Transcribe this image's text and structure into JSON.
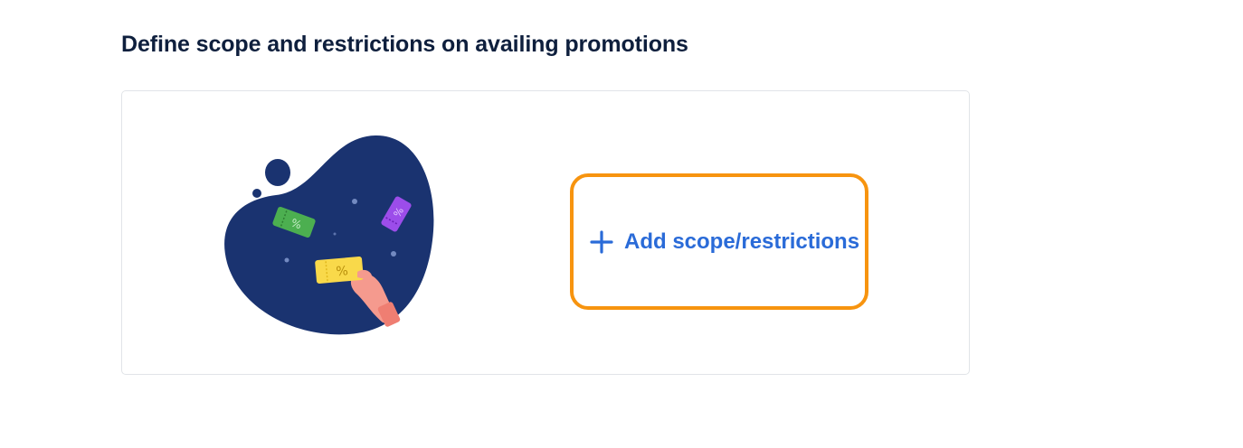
{
  "section": {
    "title": "Define scope and restrictions on availing promotions"
  },
  "card": {
    "illustration_icon": "coupon-tickets-hand-illustration",
    "add_button": {
      "icon": "plus-icon",
      "label": "Add scope/restrictions"
    }
  },
  "colors": {
    "title_text": "#0e1f3d",
    "link_blue": "#2a6bd8",
    "highlight_orange": "#f7940f",
    "blob_navy": "#1a3370",
    "card_border": "#e1e4e8"
  }
}
